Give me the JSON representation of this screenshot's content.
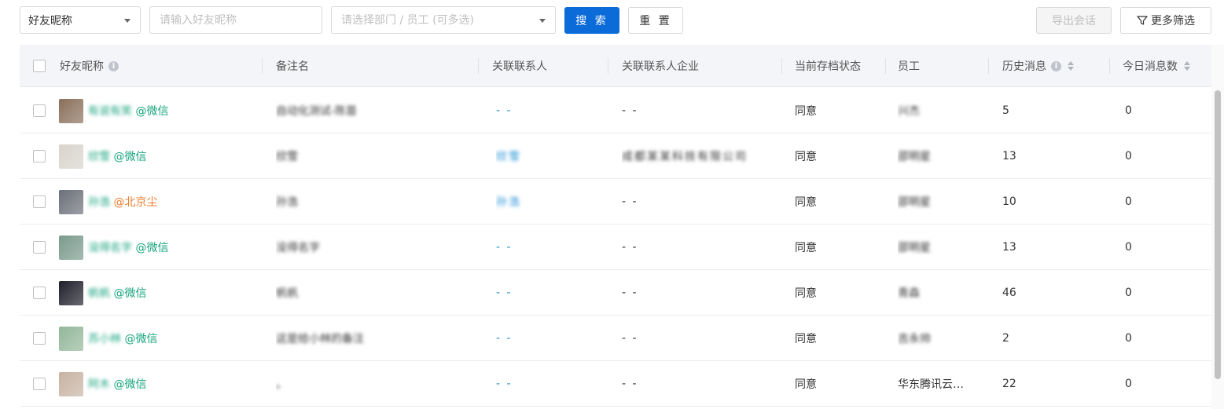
{
  "filters": {
    "nickname_select": "好友昵称",
    "nickname_placeholder": "请输入好友昵称",
    "dept_placeholder": "请选择部门 / 员工 (可多选)",
    "search_label": "搜 索",
    "reset_label": "重 置",
    "export_label": "导出会话",
    "more_filters_label": "更多筛选"
  },
  "table": {
    "columns": [
      "好友昵称",
      "备注名",
      "关联联系人",
      "关联联系人企业",
      "当前存档状态",
      "员工",
      "历史消息",
      "今日消息数"
    ],
    "rows": [
      {
        "nick": "有说有笑",
        "source": "@微信",
        "source_type": "wx",
        "remark": "自动化测试-陈苗",
        "contact": "- -",
        "contact_link": true,
        "company": "- -",
        "status": "同意",
        "employee": "兴杰",
        "history": "5",
        "today": "0",
        "avatar": "#8a6f5a"
      },
      {
        "nick": "欣雪",
        "source": "@微信",
        "source_type": "wx",
        "remark": "欣雪",
        "contact": "欣雪",
        "contact_link": true,
        "company": "成都某某科技有限公司",
        "status": "同意",
        "employee": "邵明星",
        "history": "13",
        "today": "0",
        "avatar": "#d8d4cc"
      },
      {
        "nick": "孙浩",
        "source": "@北京尘",
        "source_type": "corp",
        "remark": "孙浩",
        "contact": "孙浩",
        "contact_link": true,
        "company": "- -",
        "status": "同意",
        "employee": "邵明星",
        "history": "10",
        "today": "0",
        "avatar": "#6b6f78"
      },
      {
        "nick": "没得名字",
        "source": "@微信",
        "source_type": "wx",
        "remark": "没得名字",
        "contact": "- -",
        "contact_link": true,
        "company": "- -",
        "status": "同意",
        "employee": "邵明星",
        "history": "13",
        "today": "0",
        "avatar": "#7a9a8c"
      },
      {
        "nick": "帆帆",
        "source": "@微信",
        "source_type": "wx",
        "remark": "帆帆",
        "contact": "- -",
        "contact_link": true,
        "company": "- -",
        "status": "同意",
        "employee": "青森",
        "history": "46",
        "today": "0",
        "avatar": "#1e1f2a"
      },
      {
        "nick": "苏小林",
        "source": "@微信",
        "source_type": "wx",
        "remark": "这是给小林的备注",
        "contact": "- -",
        "contact_link": true,
        "company": "- -",
        "status": "同意",
        "employee": "吉永帅",
        "history": "2",
        "today": "0",
        "avatar": "#93b79a"
      },
      {
        "nick": "阿木",
        "source": "@微信",
        "source_type": "wx",
        "remark": "。",
        "contact": "- -",
        "contact_link": true,
        "company": "- -",
        "status": "同意",
        "employee": "华东腾讯云…",
        "history": "22",
        "today": "0",
        "avatar": "#c7b3a3"
      }
    ]
  }
}
